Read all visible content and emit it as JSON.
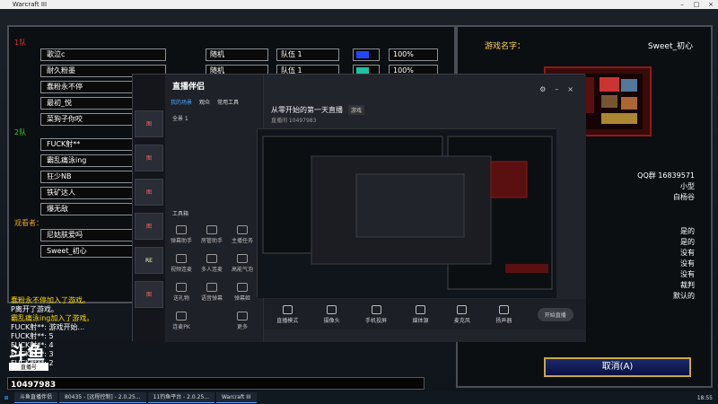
{
  "window": {
    "title": "Warcraft III"
  },
  "left": {
    "team1_label": "1队",
    "team2_label": "2队",
    "observers_label": "观看者：",
    "team1": [
      {
        "name": "歌泣c",
        "race": "随机",
        "team": "队伍 1",
        "color": "#2244ff",
        "handicap": "100%"
      },
      {
        "name": "耐久粉墨",
        "race": "随机",
        "team": "队伍 1",
        "color": "#20c0a0",
        "handicap": "100%"
      },
      {
        "name": "蠢粉永不停"
      },
      {
        "name": "最初_悦"
      },
      {
        "name": "菜狗子你咬"
      }
    ],
    "team2": [
      {
        "name": "FUCK射**"
      },
      {
        "name": "霸乱痛泳ing"
      },
      {
        "name": "狂少NB"
      },
      {
        "name": "铁矿达人"
      },
      {
        "name": "爆无敌"
      }
    ],
    "observers": [
      {
        "name": "尼姑肤爱吗"
      },
      {
        "name": "Sweet_初心"
      }
    ]
  },
  "right": {
    "game_name_label": "游戏名字：",
    "host": "Sweet_初心",
    "qq": "QQ群 16839571",
    "lines": [
      "小型",
      "白杨谷",
      "是的",
      "是的",
      "没有",
      "没有",
      "没有",
      "裁判",
      "默认的"
    ],
    "cancel_label": "取消(A)"
  },
  "chat": [
    {
      "text": "蠢粉永不停加入了游戏。",
      "style": "w"
    },
    {
      "text": "P离开了游戏。",
      "style": "n"
    },
    {
      "text": "霸乱痛泳ing加入了游戏。",
      "style": "w"
    },
    {
      "text": "FUCK射**: 游戏开始...",
      "style": "n"
    },
    {
      "text": "FUCK射**: 5",
      "style": "n"
    },
    {
      "text": "FUCK射**: 4",
      "style": "n"
    },
    {
      "text": "FUCK射**: 3",
      "style": "n"
    },
    {
      "text": "FUCK射**: 2",
      "style": "n"
    }
  ],
  "watermark": {
    "logo": "斗鱼",
    "sub": "直播号",
    "id": "10497983"
  },
  "overlay": {
    "app_name": "直播伴侣",
    "tabs": [
      "我的场景",
      "观众",
      "常用工具"
    ],
    "scene_label": "全景 1",
    "room_title": "从零开始的第一天直播",
    "room_tag": "游戏",
    "room_meta": "直播间 10497983",
    "toolbox_label": "工具箱",
    "tools": [
      "弹幕助手",
      "房管助手",
      "主播任务",
      "视频连麦",
      "多人连麦",
      "高能气泡",
      "送礼物",
      "语音弹幕",
      "弹幕姬",
      "连麦PK",
      "更多"
    ],
    "bottom": [
      "直播模式",
      "摄像头",
      "手机投屏",
      "媒体源",
      "麦克风",
      "扬声器"
    ],
    "start_label": "开始直播"
  },
  "taskbar": {
    "items": [
      "斗鱼直播伴侣",
      "80435 - [远程控制] - 2.0.25...",
      "11钓鱼平台 - 2.0.25...",
      "Warcraft III"
    ],
    "clock": "18:55"
  }
}
